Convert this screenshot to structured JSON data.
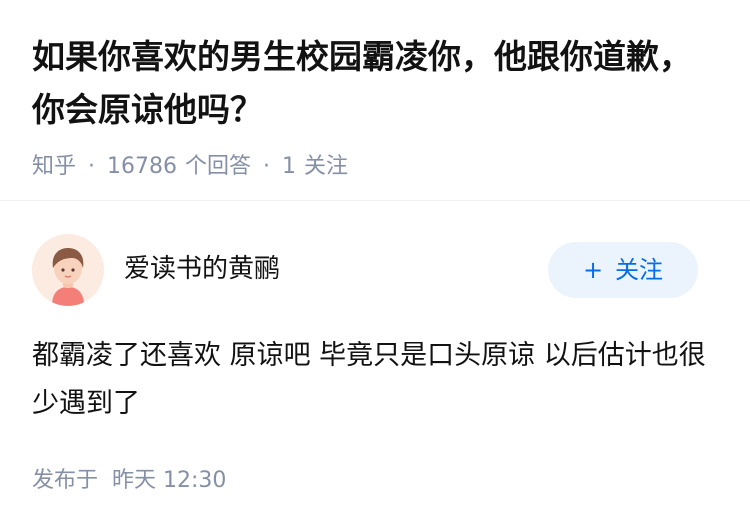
{
  "question": {
    "title": "如果你喜欢的男生校园霸凌你，他跟你道歉，你会原谅他吗？",
    "source": "知乎",
    "separator": "·",
    "answer_count": "16786",
    "answer_count_label": "个回答",
    "follower_count": "1",
    "follower_label": "关注"
  },
  "author": {
    "name": "爱读书的黄鹂",
    "avatar_icon": "avatar-illustration-icon",
    "follow_plus": "+",
    "follow_label": "关注"
  },
  "answer": {
    "content": "都霸凌了还喜欢 原谅吧 毕竟只是口头原谅 以后估计也很少遇到了",
    "published_label": "发布于",
    "published_time": "昨天 12:30"
  },
  "colors": {
    "accent": "#056de8",
    "follow_bg": "#ebf3fc",
    "meta_text": "#8590a6",
    "primary_text": "#121212"
  }
}
